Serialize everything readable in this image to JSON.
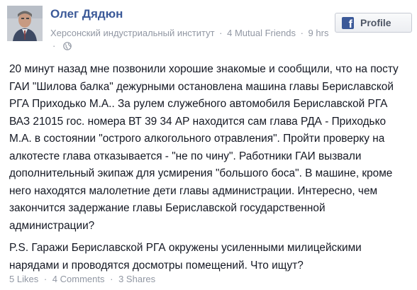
{
  "author": {
    "name": "Олег Дядюн",
    "subtitle": "Херсонский индустриальный институт",
    "mutual_friends": "4 Mutual Friends",
    "time": "9 hrs"
  },
  "profile_button": {
    "label": "Profile",
    "icon": "facebook-icon",
    "icon_glyph": "f"
  },
  "post": {
    "paragraphs": [
      "20 минут назад мне позвонили хорошие знакомые и сообщили, что на посту ГАИ \"Шилова балка\" дежурными остановлена машина главы Бериславской РГА Приходько М.А.. За рулем служебного автомобиля Бериславской РГА ВАЗ 21015 гос. номера ВТ 39 34 АР находится сам глава РДА - Приходько М.А. в состоянии \"острого алкогольного отравления\". Пройти проверку на алкотесте глава отказывается - \"не по чину\". Работники ГАИ вызвали дополнительный экипаж для усмирения \"большого боса\". В машине, кроме него находятся малолетние дети главы администрации. Интересно, чем закончится задержание главы Бериславской государственной администрации?",
      "P.S. Гаражи Бериславской РГА окружены усиленными милицейскими нарядами и проводятся досмотры помещений. Что ищут?"
    ]
  },
  "footer": {
    "likes": "5 Likes",
    "comments": "4 Comments",
    "shares": "3 Shares",
    "separator": "·"
  },
  "colors": {
    "link": "#3b5998",
    "meta": "#9197a3",
    "text": "#141823"
  }
}
